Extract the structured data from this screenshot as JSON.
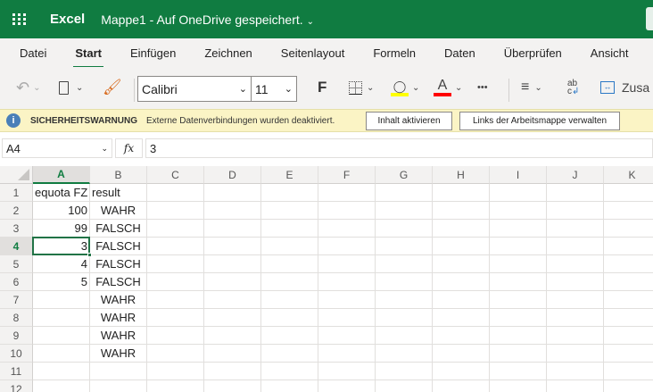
{
  "header": {
    "app_name": "Excel",
    "doc_title": "Mappe1 - Auf OneDrive gespeichert."
  },
  "tabs": [
    "Datei",
    "Start",
    "Einfügen",
    "Zeichnen",
    "Seitenlayout",
    "Formeln",
    "Daten",
    "Überprüfen",
    "Ansicht"
  ],
  "toolbar": {
    "font_name": "Calibri",
    "font_size": "11",
    "bold_label": "F",
    "font_color_label": "A",
    "more_label": "•••",
    "wrap_label": "Zusa",
    "fill_color": "#ffff00",
    "font_color": "#ff0000"
  },
  "warning": {
    "title": "SICHERHEITSWARNUNG",
    "message": "Externe Datenverbindungen wurden deaktiviert.",
    "enable_button": "Inhalt aktivieren",
    "links_button": "Links der Arbeitsmappe verwalten"
  },
  "formula_bar": {
    "name_box": "A4",
    "fx_label": "fx",
    "value": "3"
  },
  "sheet": {
    "columns": [
      "A",
      "B",
      "C",
      "D",
      "E",
      "F",
      "G",
      "H",
      "I",
      "J",
      "K"
    ],
    "rows": [
      "1",
      "2",
      "3",
      "4",
      "5",
      "6",
      "7",
      "8",
      "9",
      "10",
      "11",
      "12"
    ],
    "active_cell": "A4",
    "cells": [
      [
        "equota FZ",
        "result"
      ],
      [
        "100",
        "WAHR"
      ],
      [
        "99",
        "FALSCH"
      ],
      [
        "3",
        "FALSCH"
      ],
      [
        "4",
        "FALSCH"
      ],
      [
        "5",
        "FALSCH"
      ],
      [
        "",
        "WAHR"
      ],
      [
        "",
        "WAHR"
      ],
      [
        "",
        "WAHR"
      ],
      [
        "",
        "WAHR"
      ],
      [
        "",
        ""
      ],
      [
        "",
        ""
      ]
    ]
  }
}
